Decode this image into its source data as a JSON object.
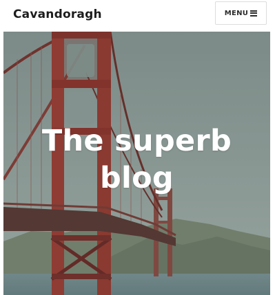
{
  "header": {
    "site_title": "Cavandoragh",
    "menu_label": "MENU",
    "menu_icon": "hamburger-icon"
  },
  "hero": {
    "title": "The superb blog",
    "image": "golden-gate-bridge-photo"
  }
}
